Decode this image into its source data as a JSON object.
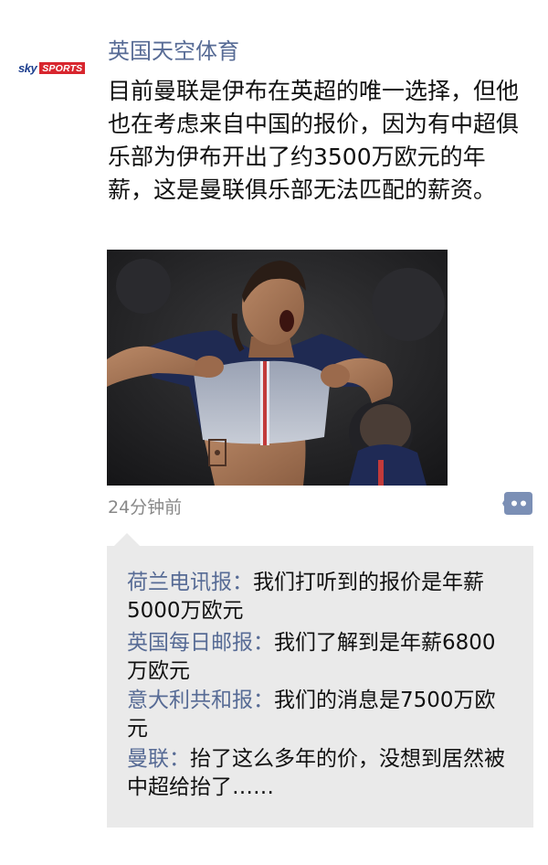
{
  "post": {
    "avatar": {
      "sky": "sky",
      "sports": "SPORTS"
    },
    "author": "英国天空体育",
    "text": "目前曼联是伊布在英超的唯一选择，但他也在考虑来自中国的报价，因为有中超俱乐部为伊布开出了约3500万欧元的年薪，这是曼联俱乐部无法匹配的薪资。",
    "image_alt": "photo",
    "time": "24分钟前",
    "comment_icon": "comment-dots-icon"
  },
  "comments": [
    {
      "author": "荷兰电讯报：",
      "text": "我们打听到的报价是年薪5000万欧元"
    },
    {
      "author": "英国每日邮报：",
      "text": "我们了解到是年薪6800万欧元"
    },
    {
      "author": "意大利共和报：",
      "text": "我们的消息是7500万欧元"
    },
    {
      "author": "曼联：",
      "text": "抬了这么多年的价，没想到居然被中超给抬了……"
    }
  ],
  "colors": {
    "link": "#576b95",
    "comment_bg": "#eaeaea",
    "icon_bg": "#7b8fb5"
  }
}
